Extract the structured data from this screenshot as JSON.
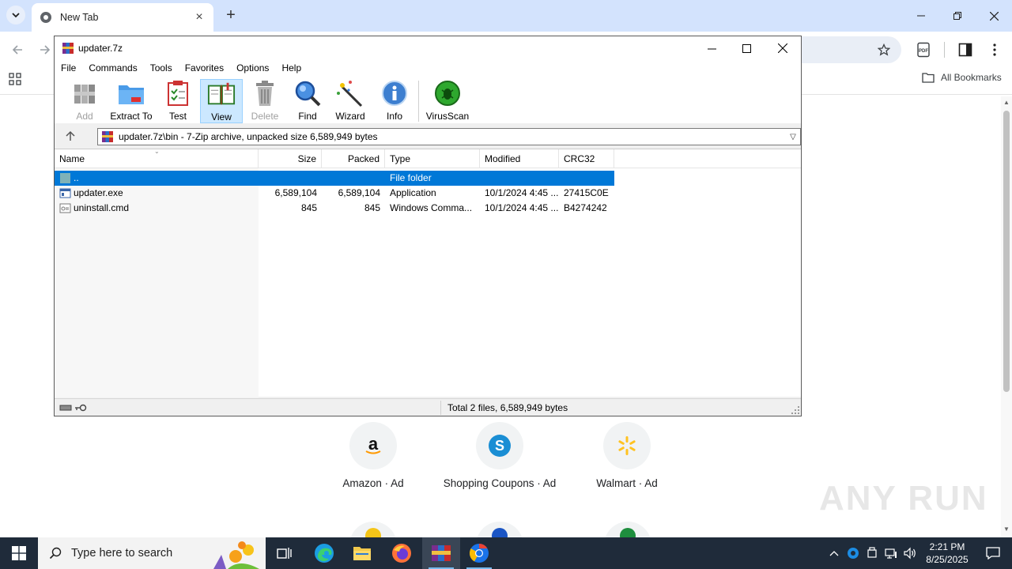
{
  "browser": {
    "tab_title": "New Tab",
    "bookmarks_label": "All Bookmarks"
  },
  "shortcuts": [
    {
      "label": "Amazon · Ad",
      "icon": "amazon-logo"
    },
    {
      "label": "Shopping Coupons · Ad",
      "icon": "shopping-coupons-logo"
    },
    {
      "label": "Walmart · Ad",
      "icon": "walmart-logo"
    }
  ],
  "watermark": "ANY RUN",
  "zip": {
    "title": "updater.7z",
    "menu": [
      "File",
      "Commands",
      "Tools",
      "Favorites",
      "Options",
      "Help"
    ],
    "toolbar": {
      "add": "Add",
      "extract": "Extract To",
      "test": "Test",
      "view": "View",
      "delete": "Delete",
      "find": "Find",
      "wizard": "Wizard",
      "info": "Info",
      "virusscan": "VirusScan"
    },
    "address": "updater.7z\\bin - 7-Zip archive, unpacked size 6,589,949 bytes",
    "columns": {
      "name": "Name",
      "size": "Size",
      "packed": "Packed",
      "type": "Type",
      "modified": "Modified",
      "crc": "CRC32"
    },
    "rows": [
      {
        "name": "..",
        "size": "",
        "packed": "",
        "type": "File folder",
        "modified": "",
        "crc": ""
      },
      {
        "name": "updater.exe",
        "size": "6,589,104",
        "packed": "6,589,104",
        "type": "Application",
        "modified": "10/1/2024 4:45 ...",
        "crc": "27415C0E"
      },
      {
        "name": "uninstall.cmd",
        "size": "845",
        "packed": "845",
        "type": "Windows Comma...",
        "modified": "10/1/2024 4:45 ...",
        "crc": "B4274242"
      }
    ],
    "status": "Total 2 files, 6,589,949 bytes"
  },
  "taskbar": {
    "search_placeholder": "Type here to search",
    "time": "2:21 PM",
    "date": "8/25/2025"
  }
}
